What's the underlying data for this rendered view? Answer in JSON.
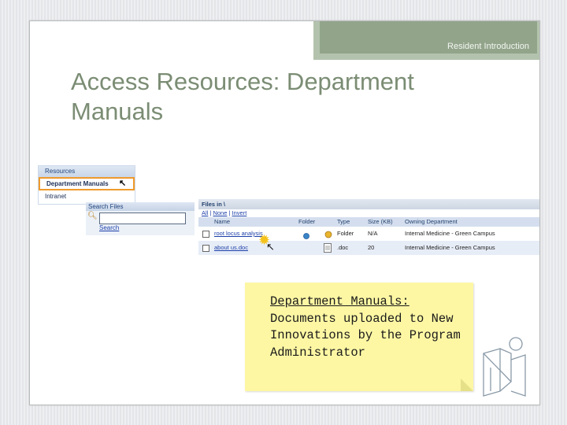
{
  "header": {
    "banner_text": "Resident Introduction"
  },
  "slide": {
    "title": "Access Resources: Department Manuals"
  },
  "resources_panel": {
    "heading": "Resources",
    "items": [
      "Department Manuals",
      "Intranet"
    ],
    "selected": "Department Manuals"
  },
  "search_panel": {
    "heading": "Search Files",
    "search_value": "",
    "search_link": "Search"
  },
  "files_panel": {
    "heading": "Files in \\",
    "select_links": [
      "All",
      "None",
      "Invert"
    ],
    "columns": [
      "Name",
      "Folder",
      "Type",
      "Size (KB)",
      "Owning Department"
    ],
    "rows": [
      {
        "name": "root locus analysis",
        "folder_icon": "globe-icon",
        "type": "Folder",
        "size": "N/A",
        "department": "Internal Medicine - Green Campus"
      },
      {
        "name": "about us.doc",
        "folder_icon": "document-icon",
        "type": ".doc",
        "size": "20",
        "department": "Internal Medicine - Green Campus"
      }
    ]
  },
  "note": {
    "heading": "Department Manuals:",
    "body": "Documents uploaded to New Innovations by the Program Administrator"
  },
  "colors": {
    "banner": "#92a58b",
    "title": "#7b8d74",
    "note_bg": "#fdf7a4",
    "highlight": "#ef9a2c"
  }
}
